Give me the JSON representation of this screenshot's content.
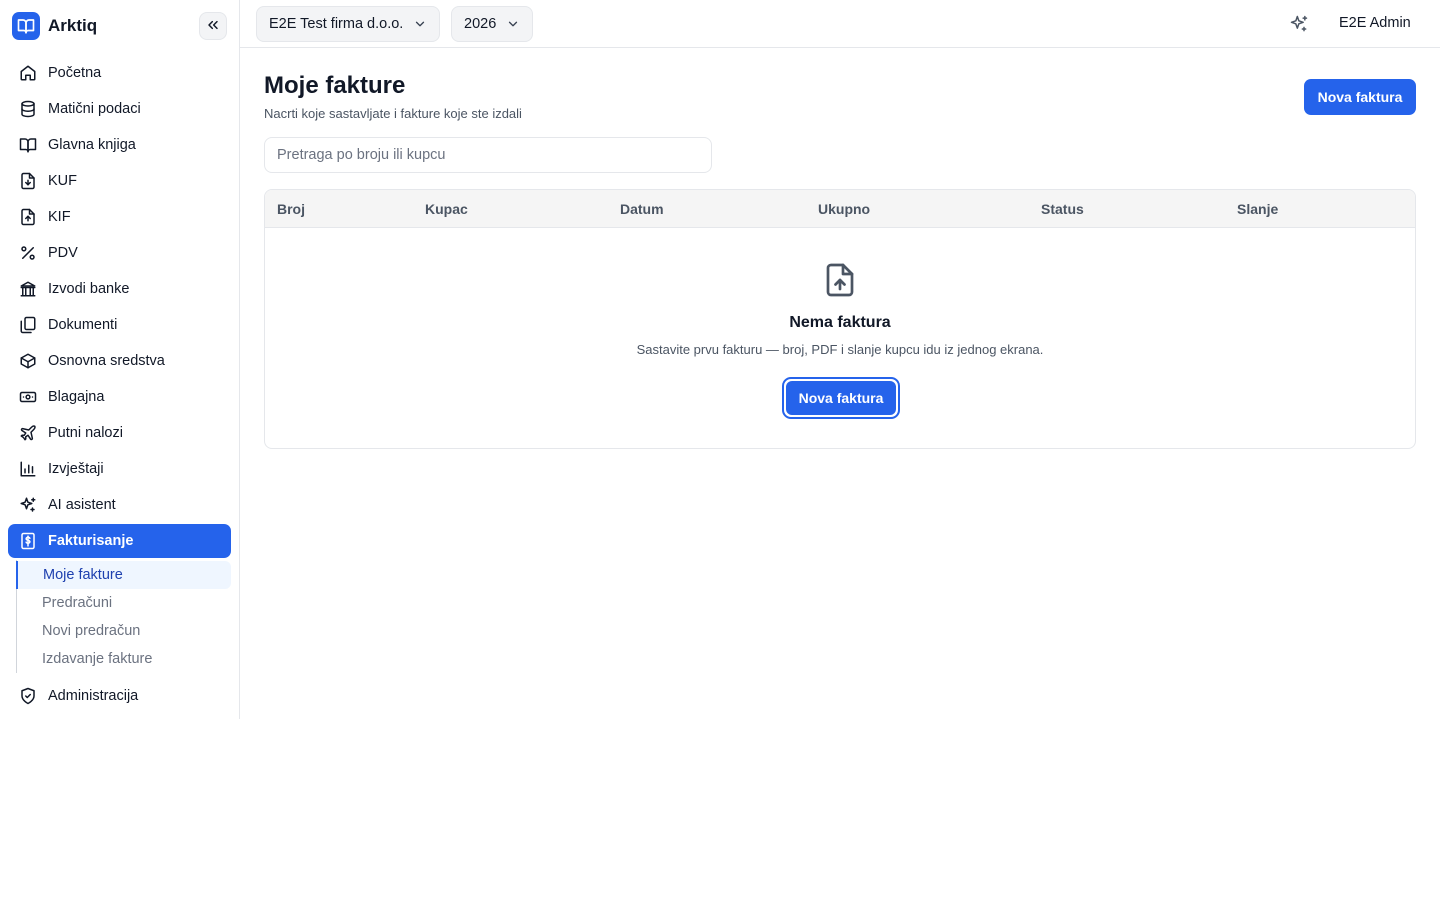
{
  "brand": {
    "name": "Arktiq",
    "accent": "#2563eb"
  },
  "sidebar": {
    "collapse_icon": "chevrons-left-icon",
    "items": [
      {
        "label": "Početna",
        "icon": "home-icon"
      },
      {
        "label": "Matični podaci",
        "icon": "database-icon"
      },
      {
        "label": "Glavna knjiga",
        "icon": "book-open-icon"
      },
      {
        "label": "KUF",
        "icon": "file-download-icon"
      },
      {
        "label": "KIF",
        "icon": "file-upload-icon"
      },
      {
        "label": "PDV",
        "icon": "percent-icon"
      },
      {
        "label": "Izvodi banke",
        "icon": "bank-icon"
      },
      {
        "label": "Dokumenti",
        "icon": "documents-icon"
      },
      {
        "label": "Osnovna sredstva",
        "icon": "box-icon"
      },
      {
        "label": "Blagajna",
        "icon": "cash-icon"
      },
      {
        "label": "Putni nalozi",
        "icon": "plane-icon"
      },
      {
        "label": "Izvještaji",
        "icon": "bar-chart-icon"
      },
      {
        "label": "AI asistent",
        "icon": "sparkles-icon"
      },
      {
        "label": "Fakturisanje",
        "icon": "invoice-dollar-icon",
        "active": true
      }
    ],
    "sub_items": [
      {
        "label": "Moje fakture",
        "active": true
      },
      {
        "label": "Predračuni"
      },
      {
        "label": "Novi predračun"
      },
      {
        "label": "Izdavanje fakture"
      }
    ],
    "admin": {
      "label": "Administracija",
      "icon": "shield-check-icon"
    }
  },
  "topbar": {
    "company": "E2E Test firma d.o.o.",
    "year": "2026",
    "user": "E2E Admin"
  },
  "main": {
    "title": "Moje fakture",
    "subtitle": "Nacrti koje sastavljate i fakture koje ste izdali",
    "new_button": "Nova faktura",
    "search_placeholder": "Pretraga po broju ili kupcu",
    "columns": [
      "Broj",
      "Kupac",
      "Datum",
      "Ukupno",
      "Status",
      "Slanje"
    ],
    "empty": {
      "title": "Nema faktura",
      "description": "Sastavite prvu fakturu — broj, PDF i slanje kupcu idu iz jednog ekrana.",
      "button": "Nova faktura"
    }
  }
}
